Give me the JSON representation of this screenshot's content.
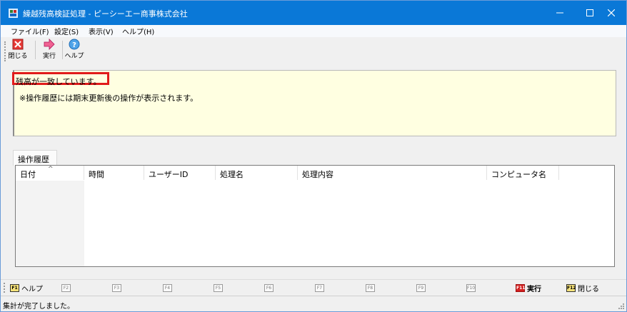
{
  "window": {
    "title": "繰越残高検証処理 - ピーシーエー商事株式会社",
    "icon": "app-icon",
    "controls": [
      "minimize-icon",
      "maximize-icon",
      "close-icon"
    ]
  },
  "menu": {
    "file": "ファイル(F)",
    "settings": "設定(S)",
    "view": "表示(V)",
    "help": "ヘルプ(H)"
  },
  "toolbar": {
    "close_label": "閉じる",
    "run_label": "実行",
    "help_label": "ヘルプ"
  },
  "message": {
    "line1": "残高が一致しています。",
    "line2": "※操作履歴には期末更新後の操作が表示されます。"
  },
  "tabs": {
    "history": "操作履歴"
  },
  "history_table": {
    "sort_indicator": "^",
    "columns": [
      "日付",
      "時間",
      "ユーザーID",
      "処理名",
      "処理内容",
      "コンピュータ名"
    ],
    "rows": []
  },
  "fkeys": [
    {
      "key": "F1",
      "label": "ヘルプ"
    },
    {
      "key": "F2",
      "label": ""
    },
    {
      "key": "F3",
      "label": ""
    },
    {
      "key": "F4",
      "label": ""
    },
    {
      "key": "F5",
      "label": ""
    },
    {
      "key": "F6",
      "label": ""
    },
    {
      "key": "F7",
      "label": ""
    },
    {
      "key": "F8",
      "label": ""
    },
    {
      "key": "F9",
      "label": ""
    },
    {
      "key": "F10",
      "label": ""
    },
    {
      "key": "F11",
      "label": "実行"
    },
    {
      "key": "F12",
      "label": "閉じる"
    }
  ],
  "status": {
    "text": "集計が完了しました。"
  },
  "colors": {
    "titlebar": "#0a78d7",
    "message_bg": "#ffffe1",
    "highlight_border": "#e11b1b",
    "f11_key": "#d42020",
    "f1_f12_key": "#f6e27a"
  }
}
